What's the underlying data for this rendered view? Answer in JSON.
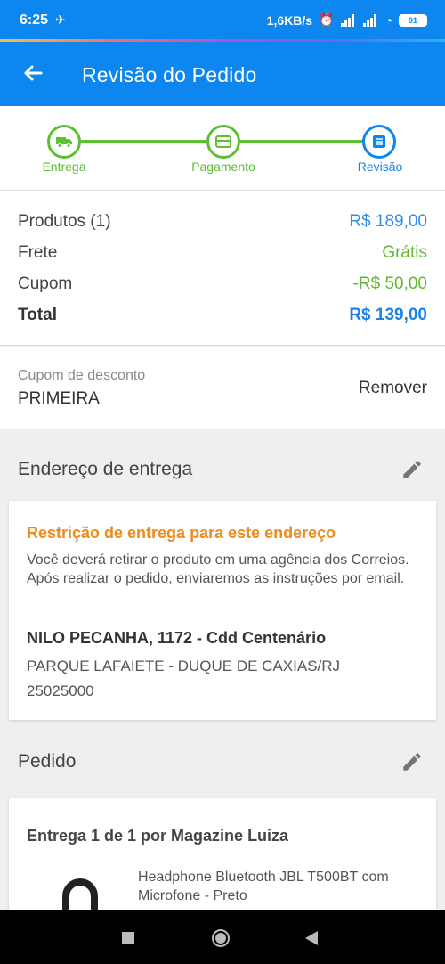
{
  "status": {
    "time": "6:25",
    "speed": "1,6KB/s",
    "battery": "91"
  },
  "appbar": {
    "title": "Revisão do Pedido",
    "back_icon": "arrow-left-icon"
  },
  "stepper": {
    "steps": [
      {
        "label": "Entrega",
        "icon": "truck-icon"
      },
      {
        "label": "Pagamento",
        "icon": "card-icon"
      },
      {
        "label": "Revisão",
        "icon": "list-icon"
      }
    ],
    "colors": {
      "done": "#5bc130",
      "current": "#0e86f0"
    }
  },
  "summary": {
    "products_label": "Produtos (1)",
    "products_value": "R$ 189,00",
    "shipping_label": "Frete",
    "shipping_value": "Grátis",
    "coupon_label": "Cupom",
    "coupon_value": "-R$ 50,00",
    "total_label": "Total",
    "total_value": "R$ 139,00"
  },
  "coupon": {
    "label": "Cupom de desconto",
    "code": "PRIMEIRA",
    "remove": "Remover"
  },
  "address": {
    "section_title": "Endereço de entrega",
    "warning": "Restrição de entrega para este endereço",
    "info": "Você deverá retirar o produto em uma agência dos Correios. Após realizar o pedido, enviaremos as instruções por email.",
    "street": "NILO PECANHA, 1172 - Cdd Centenário",
    "city": "PARQUE LAFAIETE - DUQUE DE CAXIAS/RJ",
    "zip": "25025000"
  },
  "order": {
    "section_title": "Pedido",
    "shipping": "Entrega 1 de 1 por Magazine Luiza",
    "product_name": "Headphone Bluetooth JBL T500BT com Microfone - Preto"
  },
  "colors": {
    "primary": "#0e86f0",
    "success": "#5bc130",
    "warning": "#ef8a1b"
  }
}
